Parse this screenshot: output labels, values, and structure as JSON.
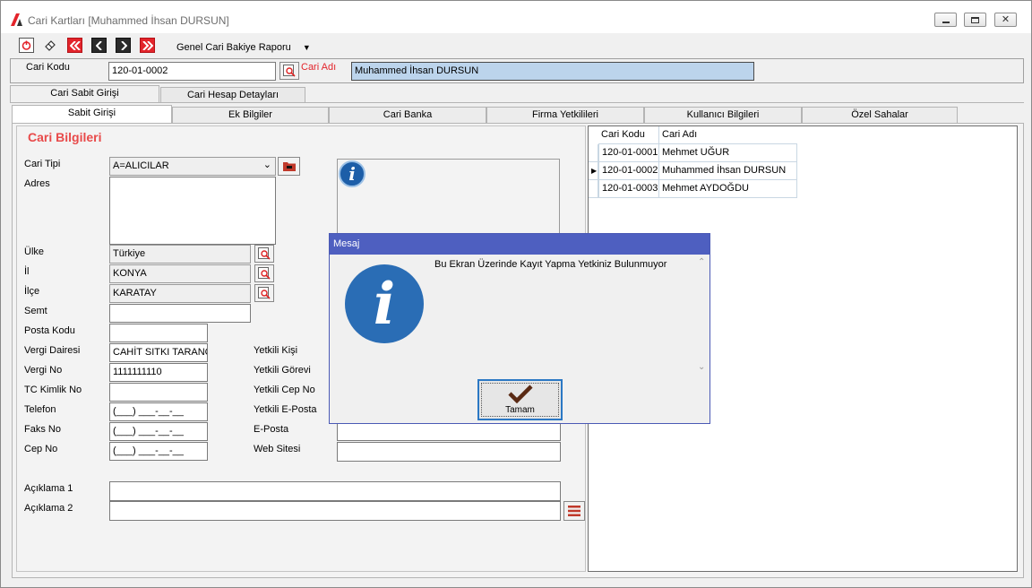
{
  "window": {
    "title": "Cari Kartları [Muhammed İhsan DURSUN]"
  },
  "toolbar": {
    "report_menu": "Genel Cari Bakiye Raporu"
  },
  "header": {
    "code_label": "Cari Kodu",
    "code_value": "120-01-0002",
    "name_label": "Cari Adı",
    "name_value": "Muhammed İhsan DURSUN"
  },
  "outer_tabs": [
    "Cari Sabit Girişi",
    "Cari Hesap Detayları"
  ],
  "inner_tabs": [
    "Sabit Girişi",
    "Ek Bilgiler",
    "Cari Banka",
    "Firma Yetkilileri",
    "Kullanıcı Bilgileri",
    "Özel Sahalar"
  ],
  "form": {
    "section_title": "Cari Bilgileri",
    "cari_tipi_label": "Cari Tipi",
    "cari_tipi_value": "A=ALICILAR",
    "adres_label": "Adres",
    "ulke_label": "Ülke",
    "ulke_value": "Türkiye",
    "il_label": "İl",
    "il_value": "KONYA",
    "ilce_label": "İlçe",
    "ilce_value": "KARATAY",
    "semt_label": "Semt",
    "posta_kodu_label": "Posta Kodu",
    "vergi_dairesi_label": "Vergi Dairesi",
    "vergi_dairesi_value": "CAHİT SITKI TARANCI",
    "vergi_no_label": "Vergi No",
    "vergi_no_value": "1111111110",
    "tc_label": "TC Kimlik No",
    "telefon_label": "Telefon",
    "telefon_value": "(___) ___-__-__",
    "faks_label": "Faks No",
    "faks_value": "(___) ___-__-__",
    "cep_label": "Cep No",
    "cep_value": "(___) ___-__-__",
    "yetkili_kisi_label": "Yetkili Kişi",
    "yetkili_gorevi_label": "Yetkili Görevi",
    "yetkili_cep_label": "Yetkili Cep No",
    "yetkili_eposta_label": "Yetkili E-Posta",
    "eposta_label": "E-Posta",
    "web_label": "Web Sitesi",
    "aciklama1_label": "Açıklama 1",
    "aciklama2_label": "Açıklama 2"
  },
  "grid": {
    "columns": [
      "Cari Kodu",
      "Cari Adı"
    ],
    "rows": [
      {
        "code": "120-01-0001",
        "name": "Mehmet UĞUR"
      },
      {
        "code": "120-01-0002",
        "name": "Muhammed İhsan DURSUN"
      },
      {
        "code": "120-01-0003",
        "name": "Mehmet AYDOĞDU"
      }
    ]
  },
  "dialog": {
    "title": "Mesaj",
    "message": "Bu Ekran Üzerinde Kayıt Yapma Yetkiniz Bulunmuyor",
    "ok_label": "Tamam"
  },
  "colors": {
    "dialog_title_bar": "#4e5fc0",
    "selected_field": "#bcd4ec",
    "section_title": "#e84a4a",
    "info_icon": "#1d5ea8"
  }
}
